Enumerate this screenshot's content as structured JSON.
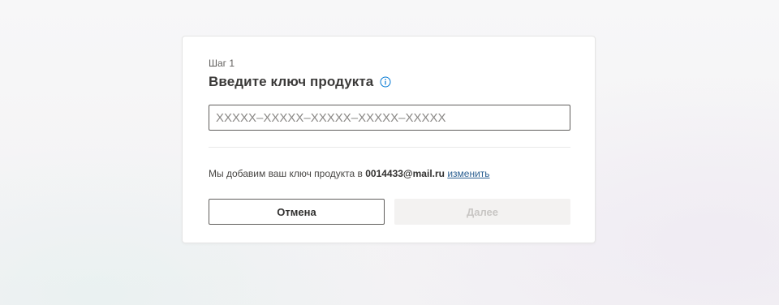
{
  "dialog": {
    "step_label": "Шаг 1",
    "title": "Введите ключ продукта",
    "info_icon": "info-circle-icon",
    "key_input": {
      "value": "",
      "placeholder": "XXXXX–XXXXX–XXXXX–XXXXX–XXXXX"
    },
    "account_prefix": "Мы добавим ваш ключ продукта в",
    "account_email": "0014433@mail.ru",
    "change_link": "изменить",
    "cancel_label": "Отмена",
    "next_label": "Далее",
    "next_disabled": true
  },
  "colors": {
    "accent_link": "#2b5f91",
    "border": "#605e5c",
    "disabled_bg": "#f3f2f1",
    "disabled_text": "#c8c6c4"
  }
}
